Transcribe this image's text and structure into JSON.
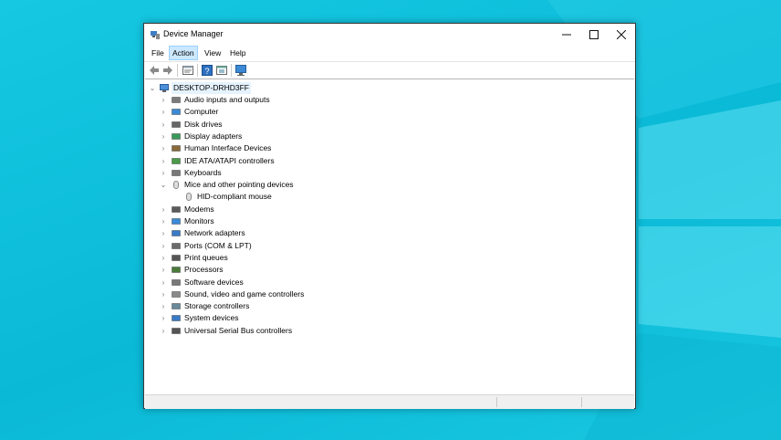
{
  "window": {
    "title": "Device Manager"
  },
  "menu": [
    "File",
    "Action",
    "View",
    "Help"
  ],
  "toolbar": [
    "back-icon",
    "forward-icon",
    "properties-icon",
    "help-icon",
    "update-driver-icon",
    "scan-hardware-icon"
  ],
  "tree": {
    "root": "DESKTOP-DRHD3FF",
    "categories": [
      {
        "label": "Audio inputs and outputs",
        "icon": "speaker-icon",
        "expanded": false
      },
      {
        "label": "Computer",
        "icon": "monitor-icon",
        "expanded": false
      },
      {
        "label": "Disk drives",
        "icon": "disk-drive-icon",
        "expanded": false
      },
      {
        "label": "Display adapters",
        "icon": "display-adapter-icon",
        "expanded": false
      },
      {
        "label": "Human Interface Devices",
        "icon": "hid-icon",
        "expanded": false
      },
      {
        "label": "IDE ATA/ATAPI controllers",
        "icon": "ide-controller-icon",
        "expanded": false
      },
      {
        "label": "Keyboards",
        "icon": "keyboard-icon",
        "expanded": false
      },
      {
        "label": "Mice and other pointing devices",
        "icon": "mouse-icon",
        "expanded": true
      },
      {
        "label": "HID-compliant mouse",
        "icon": "mouse-icon",
        "child": true
      },
      {
        "label": "Modems",
        "icon": "modem-icon",
        "expanded": false
      },
      {
        "label": "Monitors",
        "icon": "monitor-icon",
        "expanded": false
      },
      {
        "label": "Network adapters",
        "icon": "network-adapter-icon",
        "expanded": false
      },
      {
        "label": "Ports (COM & LPT)",
        "icon": "port-icon",
        "expanded": false
      },
      {
        "label": "Print queues",
        "icon": "printer-icon",
        "expanded": false
      },
      {
        "label": "Processors",
        "icon": "processor-icon",
        "expanded": false
      },
      {
        "label": "Software devices",
        "icon": "software-device-icon",
        "expanded": false
      },
      {
        "label": "Sound, video and game controllers",
        "icon": "sound-controller-icon",
        "expanded": false
      },
      {
        "label": "Storage controllers",
        "icon": "storage-controller-icon",
        "expanded": false
      },
      {
        "label": "System devices",
        "icon": "system-device-icon",
        "expanded": false
      },
      {
        "label": "Universal Serial Bus controllers",
        "icon": "usb-icon",
        "expanded": false
      }
    ]
  },
  "colors": {
    "desktop": "#0fc4df",
    "selection": "#cce8ff"
  }
}
